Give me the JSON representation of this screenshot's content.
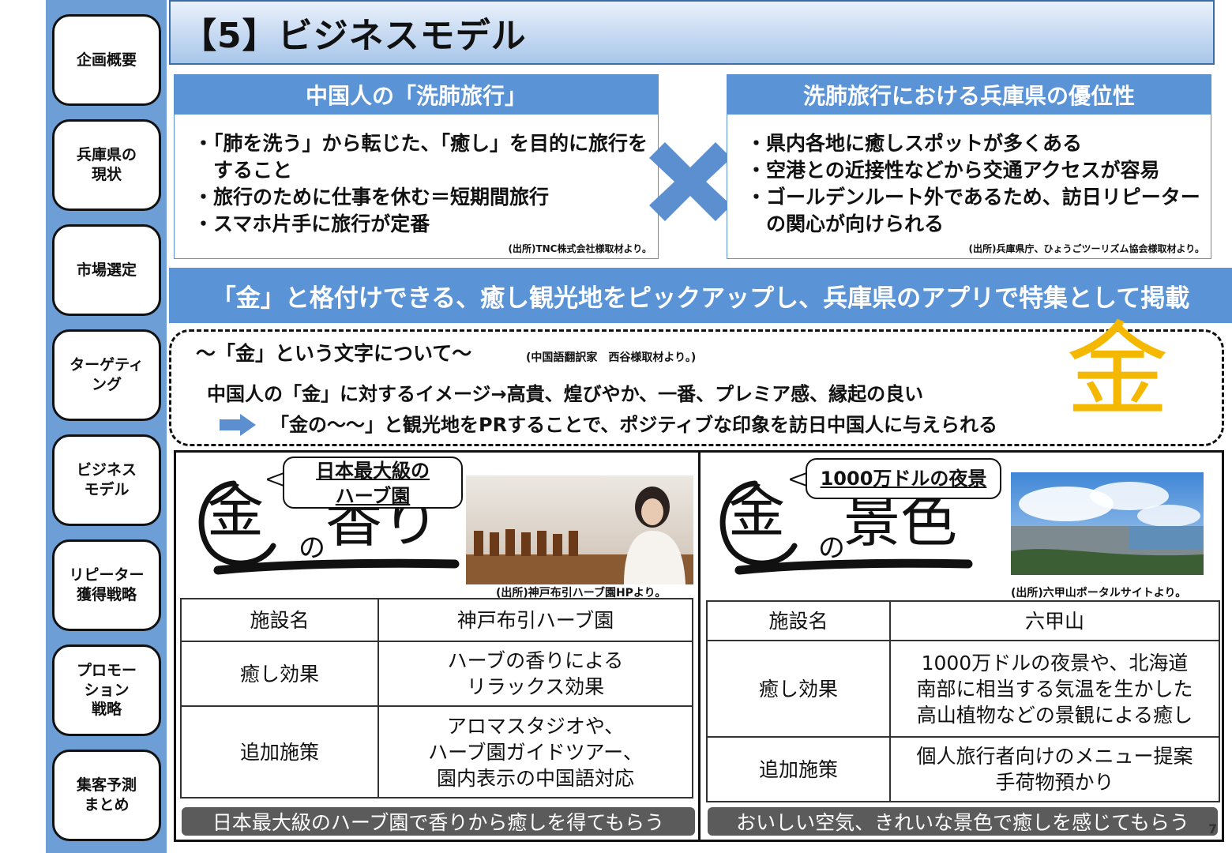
{
  "sidebar": {
    "items": [
      {
        "label": "企画概要"
      },
      {
        "label": "兵庫県の\n現状"
      },
      {
        "label": "市場選定"
      },
      {
        "label": "ターゲティ\nング"
      },
      {
        "label": "ビジネス\nモデル"
      },
      {
        "label": "リピーター\n獲得戦略"
      },
      {
        "label": "プロモー\nション\n戦略"
      },
      {
        "label": "集客予測\nまとめ"
      }
    ]
  },
  "header": {
    "title": "【5】ビジネスモデル"
  },
  "left_box": {
    "title": "中国人の「洗肺旅行」",
    "items": [
      "・「肺を洗う」から転じた、「癒し」を目的に旅行を\n　すること",
      "・旅行のために仕事を休む＝短期間旅行",
      "・スマホ片手に旅行が定番"
    ],
    "source": "(出所)TNC株式会社様取材より。"
  },
  "right_box": {
    "title": "洗肺旅行における兵庫県の優位性",
    "items": [
      "・県内各地に癒しスポットが多くある",
      "・空港との近接性などから交通アクセスが容易",
      "・ゴールデンルート外であるため、訪日リピーター\n　の関心が向けられる"
    ],
    "source": "(出所)兵庫県庁、ひょうごツーリズム協会様取材より。"
  },
  "banner": {
    "text": "「金」と格付けできる、癒し観光地をピックアップし、兵庫県のアプリで特集として掲載"
  },
  "gold_section": {
    "title": "～「金」という文字について～",
    "title_source": "(中国語翻訳家　西谷様取材より。)",
    "line1": "中国人の「金」に対するイメージ→高貴、煌びやか、一番、プレミア感、縁起の良い",
    "line2": "「金の～～」と観光地をPRすることで、ポジティブな印象を訪日中国人に与えられる",
    "big_char": "金"
  },
  "left_panel": {
    "bubble": "日本最大級の\nハーブ園",
    "kin": "金",
    "no": "の",
    "word": "香り",
    "photo_source": "(出所)神戸布引ハーブ園HPより。",
    "table": [
      [
        "施設名",
        "神戸布引ハーブ園"
      ],
      [
        "癒し効果",
        "ハーブの香りによる\nリラックス効果"
      ],
      [
        "追加施策",
        "アロマスタジオや、\nハーブ園ガイドツアー、\n園内表示の中国語対応"
      ]
    ],
    "summary": "日本最大級のハーブ園で香りから癒しを得てもらう"
  },
  "right_panel": {
    "bubble": "1000万ドルの夜景",
    "kin": "金",
    "no": "の",
    "word": "景色",
    "photo_source": "(出所)六甲山ポータルサイトより。",
    "table": [
      [
        "施設名",
        "六甲山"
      ],
      [
        "癒し効果",
        "1000万ドルの夜景や、北海道\n南部に相当する気温を生かした\n高山植物などの景観による癒し"
      ],
      [
        "追加施策",
        "個人旅行者向けのメニュー提案\n手荷物預かり"
      ]
    ],
    "summary": "おいしい空気、きれいな景色で癒しを感じてもらう"
  },
  "page_number": "7",
  "colors": {
    "sidebar": "#6d9fd6",
    "box_header": "#5a93d6",
    "gold": "#f5b800",
    "summary": "#5b5b5b"
  }
}
